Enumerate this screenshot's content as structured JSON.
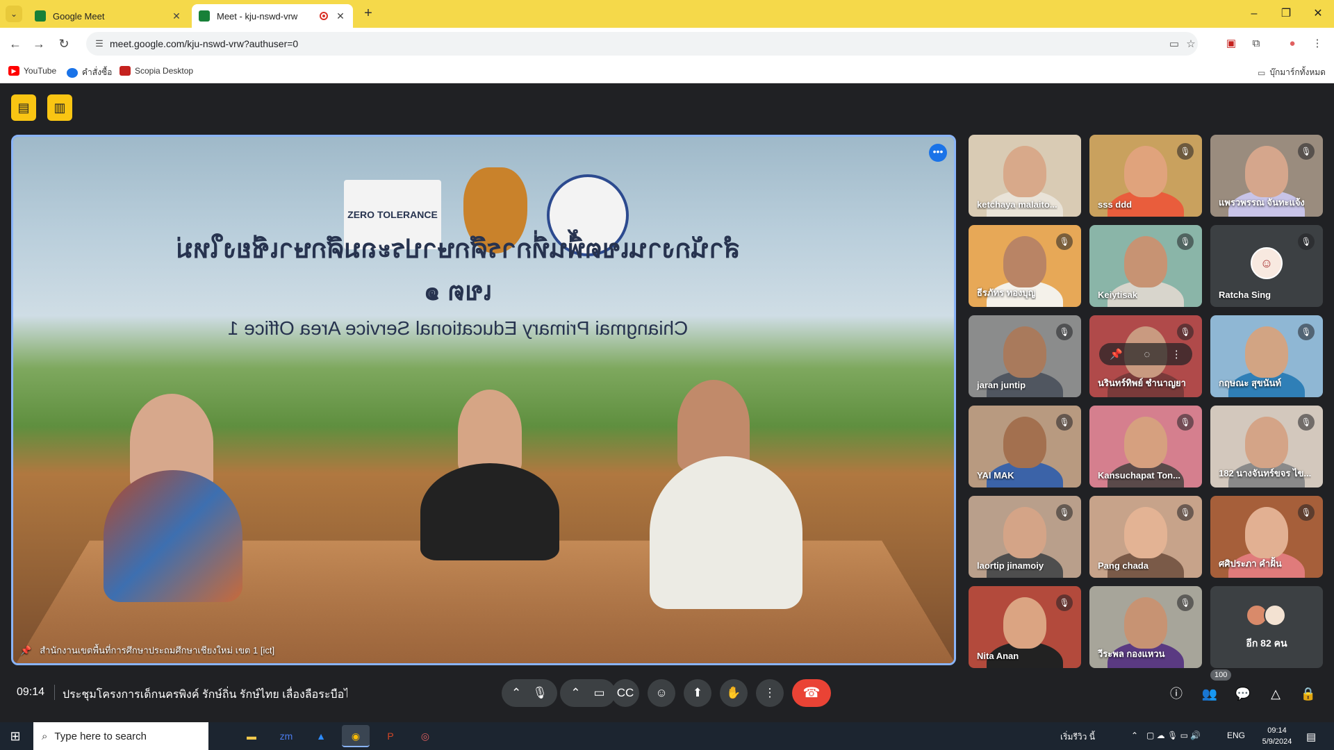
{
  "browser": {
    "tabs": [
      {
        "title": "Google Meet",
        "favicon_color": "#188038"
      },
      {
        "title": "Meet - kju-nswd-vrw",
        "favicon_color": "#188038",
        "recording": true
      }
    ],
    "url": "meet.google.com/kju-nswd-vrw?authuser=0",
    "bookmarks": [
      {
        "label": "YouTube",
        "icon": "youtube-icon",
        "color": "#ff0000"
      },
      {
        "label": "คำสั่งซื้อ",
        "icon": "orders-icon",
        "color": "#1a73e8"
      },
      {
        "label": "Scopia Desktop",
        "icon": "scopia-icon",
        "color": "#c5221f"
      }
    ],
    "all_bookmarks": "บุ๊กมาร์กทั้งหมด"
  },
  "meeting": {
    "time": "09:14",
    "title": "ประชุมโครงการเด็กนครพิงค์ รักษ์ถิ่น รักษ์ไทย เลื่องลือระบือไ...",
    "presenter_name": "สำนักงานเขตพื้นที่การศึกษาประถมศึกษาเชียงใหม่ เขต 1 [ict]",
    "banner_line1": "สำนักงานเขตพื้นที่การศึกษาประถมศึกษาเชียงใหม่ เขต ๑",
    "banner_line2": "Chiangmai Primary Educational Service Area Office 1",
    "banner_logo_text": "ZERO TOLERANCE",
    "participant_count": "100",
    "participants": [
      {
        "name": "ketchaya malaito...",
        "muted": false,
        "bg": "#d9cbb4",
        "skin": "#d8a98a",
        "shirt": "#e9e3d8"
      },
      {
        "name": "sss ddd",
        "muted": true,
        "bg": "#c9a15e",
        "skin": "#e0a37c",
        "shirt": "#e95d3c"
      },
      {
        "name": "แพรวพรรณ จันทะแจ้ง",
        "muted": true,
        "bg": "#9a8c7e",
        "skin": "#d5a68c",
        "shirt": "#c8c4e8"
      },
      {
        "name": "ธีรภัทร ทองบุญ",
        "muted": true,
        "bg": "#e7a857",
        "skin": "#b98465",
        "shirt": "#f4f1ea"
      },
      {
        "name": "Keiytisak",
        "muted": true,
        "bg": "#8ab5a8",
        "skin": "#c79373",
        "shirt": "#d8d5cc"
      },
      {
        "name": "Ratcha Sing",
        "muted": true,
        "bg": "#3c4043",
        "avatar": true
      },
      {
        "name": "jaran juntip",
        "muted": true,
        "bg": "#8b8c8c",
        "skin": "#a97a5c",
        "shirt": "#505660"
      },
      {
        "name": "นรินทร์ทิพย์ ชำนาญยา",
        "muted": true,
        "bg": "#b04a4a",
        "skin": "#c99a80",
        "shirt": "#7a3a3a",
        "pin_overlay": true
      },
      {
        "name": "กฤษณะ สุขนันท์",
        "muted": true,
        "bg": "#8fb7d4",
        "skin": "#d2a483",
        "shirt": "#2f7fb7"
      },
      {
        "name": "YAI MAK",
        "muted": true,
        "bg": "#b89a80",
        "skin": "#a3704f",
        "shirt": "#3b63a8"
      },
      {
        "name": "Kansuchapat Ton...",
        "muted": true,
        "bg": "#d57f8e",
        "skin": "#d6a07f",
        "shirt": "#5a4a4a"
      },
      {
        "name": "182 นางจันทร์ขจร ไข...",
        "muted": true,
        "bg": "#d3c8bd",
        "skin": "#d4a487",
        "shirt": "#8a8a8a"
      },
      {
        "name": "laortip jinamoiy",
        "muted": true,
        "bg": "#b99f8b",
        "skin": "#d4a487",
        "shirt": "#4e4e4e"
      },
      {
        "name": "Pang chada",
        "muted": true,
        "bg": "#c7a38a",
        "skin": "#e3b394",
        "shirt": "#7a5a48"
      },
      {
        "name": "ศศิประภา คำฝั้น",
        "muted": true,
        "bg": "#a65f3a",
        "skin": "#e2b092",
        "shirt": "#e07b7b"
      },
      {
        "name": "Nita Anan",
        "muted": true,
        "bg": "#b34a3c",
        "skin": "#dba482",
        "shirt": "#222222"
      },
      {
        "name": "วีระพล กองแหวน",
        "muted": true,
        "bg": "#a7a59a",
        "skin": "#c79373",
        "shirt": "#5a3a82"
      }
    ],
    "others_label": "อีก 82 คน"
  },
  "taskbar": {
    "search_placeholder": "Type here to search",
    "weather": "เริ่มรีวิว นี้",
    "lang": "ENG",
    "clock_time": "09:14",
    "clock_date": "5/9/2024"
  },
  "colors": {
    "accent_yellow": "#f9c513",
    "meet_bg": "#202124",
    "end_call": "#ea4335",
    "active_border": "#8ab4f8"
  }
}
